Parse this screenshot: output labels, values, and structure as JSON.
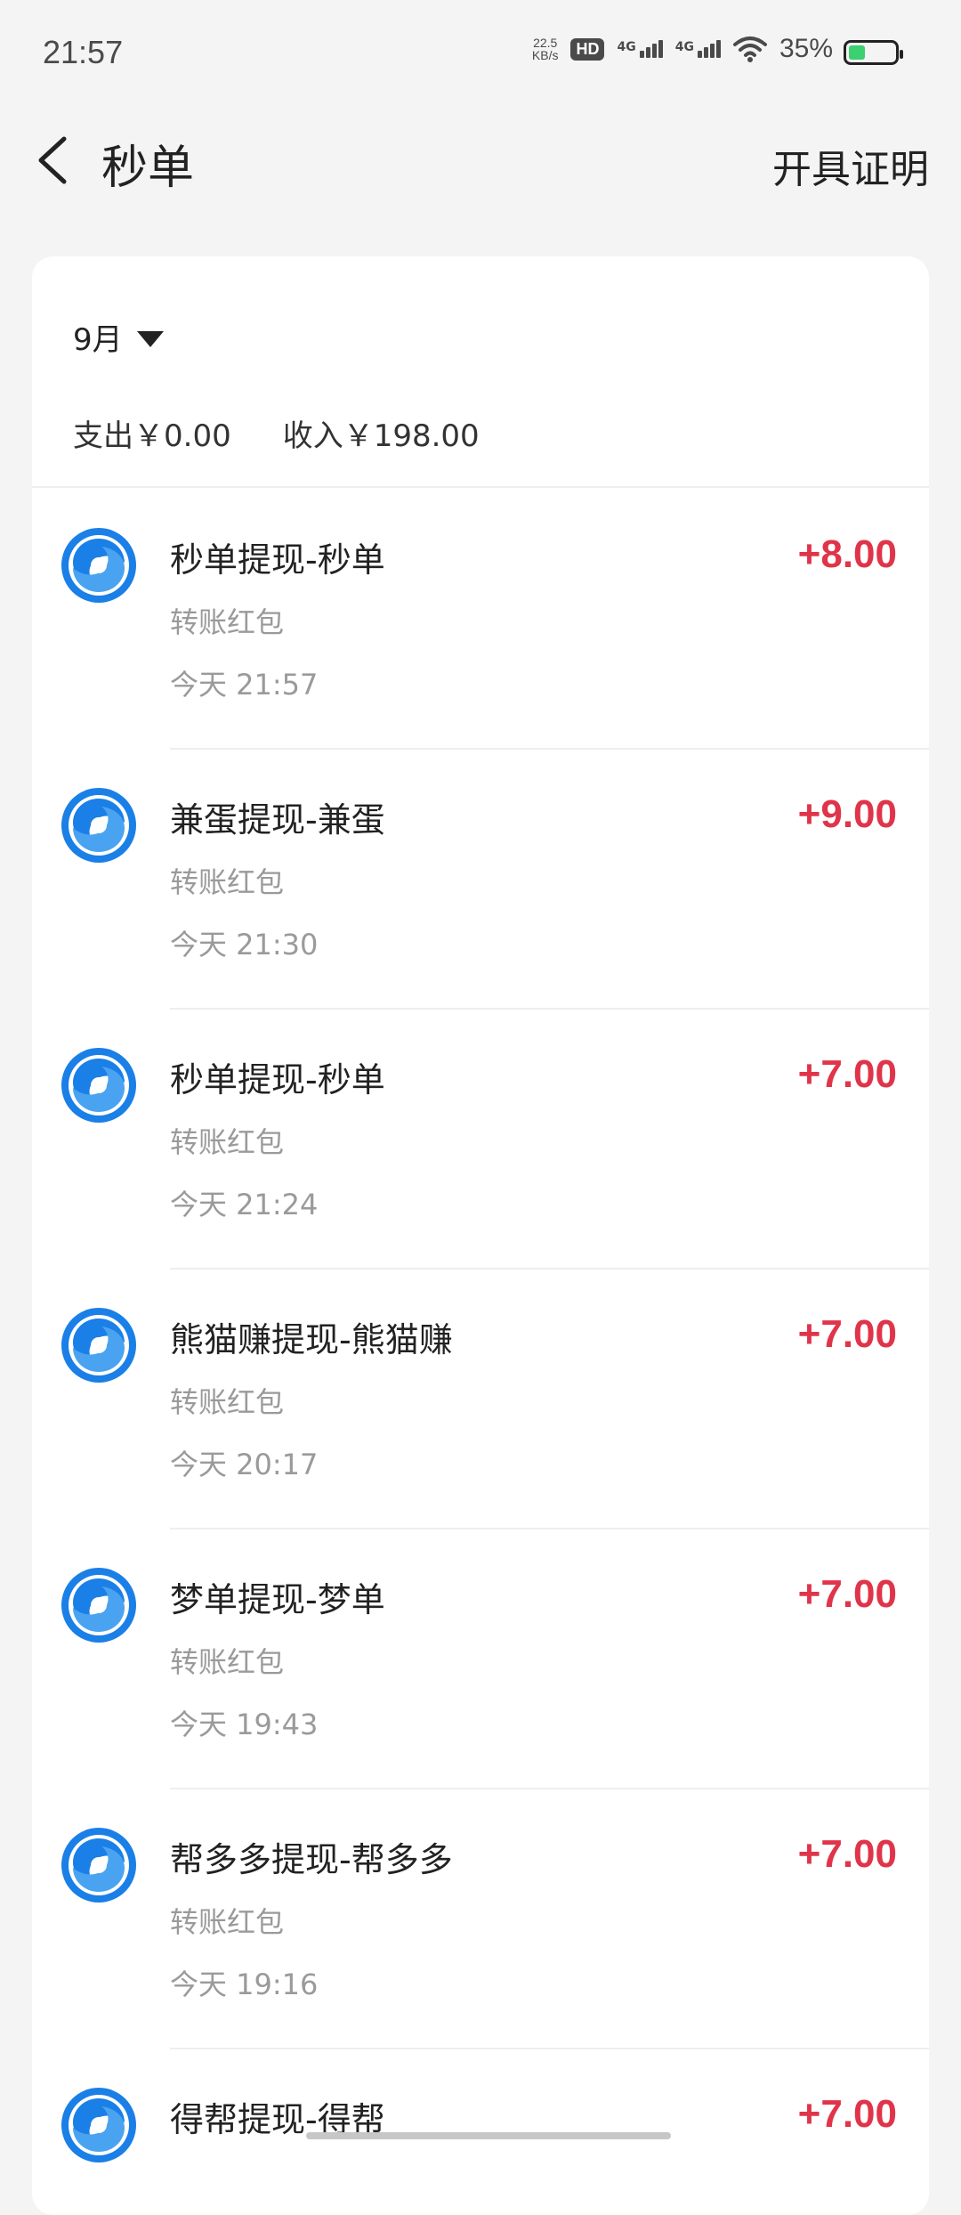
{
  "status_bar": {
    "time": "21:57",
    "net_speed_value": "22.5",
    "net_speed_unit": "KB/s",
    "hd_label": "HD",
    "sim1_label": "4G",
    "sim2_label": "4G",
    "battery_pct": "35%",
    "battery_level": 0.35,
    "battery_color": "#3cd070"
  },
  "header": {
    "title": "秒单",
    "action_label": "开具证明",
    "back_icon": "chevron-left-icon"
  },
  "filter": {
    "month_label": "9月",
    "caret_icon": "caret-down-icon"
  },
  "summary": {
    "expense_text": "支出￥0.00",
    "income_text": "收入￥198.00"
  },
  "transactions": [
    {
      "title": "秒单提现-秒单",
      "type": "转账红包",
      "time": "今天 21:57",
      "amount": "+8.00"
    },
    {
      "title": "兼蛋提现-兼蛋",
      "type": "转账红包",
      "time": "今天 21:30",
      "amount": "+9.00"
    },
    {
      "title": "秒单提现-秒单",
      "type": "转账红包",
      "time": "今天 21:24",
      "amount": "+7.00"
    },
    {
      "title": "熊猫赚提现-熊猫赚",
      "type": "转账红包",
      "time": "今天 20:17",
      "amount": "+7.00"
    },
    {
      "title": "梦单提现-梦单",
      "type": "转账红包",
      "time": "今天 19:43",
      "amount": "+7.00"
    },
    {
      "title": "帮多多提现-帮多多",
      "type": "转账红包",
      "time": "今天 19:16",
      "amount": "+7.00"
    },
    {
      "title": "得帮提现-得帮",
      "type": "",
      "time": "",
      "amount": "+7.00"
    }
  ],
  "colors": {
    "amount_positive": "#e0344a",
    "avatar_blue": "#1a7fe6",
    "background": "#f4f4f4"
  }
}
